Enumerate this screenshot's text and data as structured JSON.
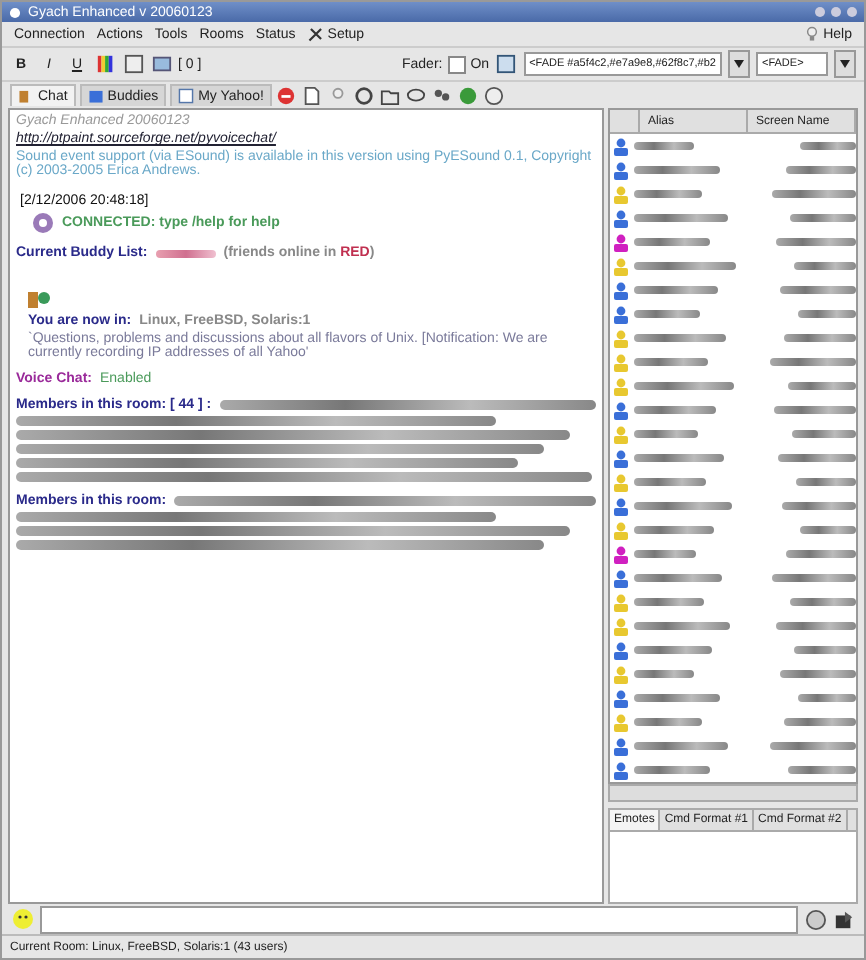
{
  "window": {
    "title": "Gyach Enhanced v 20060123"
  },
  "menu": [
    {
      "label": "Connection"
    },
    {
      "label": "Actions"
    },
    {
      "label": "Tools"
    },
    {
      "label": "Rooms"
    },
    {
      "label": "Status"
    },
    {
      "label": "Setup",
      "kind": "icon"
    }
  ],
  "help": "Help",
  "format_toolbar": {
    "format_buttons": [
      {
        "label": "B",
        "kind": "bold"
      },
      {
        "label": "I",
        "kind": "italic"
      },
      {
        "label": "U",
        "kind": "underline"
      }
    ],
    "counter": "[ 0 ]",
    "fader_label": "Fader:",
    "fader_checkbox": {
      "label": "On",
      "checked": false
    },
    "fade_field": "<FADE #a5f4c2,#e7a9e8,#62f8c7,#b2",
    "fade_field_2": "<FADE>"
  },
  "tabs": [
    {
      "label": "Chat",
      "selected": true
    },
    {
      "label": "Buddies",
      "selected": false
    },
    {
      "label": "My Yahoo!",
      "selected": false
    }
  ],
  "chat": [
    {
      "kind": "intro",
      "text": "Gyach Enhanced 20060123"
    },
    {
      "kind": "link",
      "text": "http://ptpaint.sourceforge.net/pyvoicechat/"
    },
    {
      "kind": "info",
      "text": "Sound event support (via ESound) is available in this version using PyESound 0.1, Copyright (c) 2003-2005 Erica Andrews."
    },
    {
      "kind": "timestamp",
      "text": "[2/12/2006 20:48:18]"
    },
    {
      "kind": "connected",
      "text": "CONNECTED: type /help for help"
    },
    {
      "kind": "buddies",
      "label": "Current Buddy List:",
      "before": "(friends online in ",
      "highlight": "RED",
      "after": ")"
    },
    {
      "kind": "room",
      "label": "You are now in:",
      "value": "Linux, FreeBSD, Solaris:1",
      "topic": "`Questions, problems and discussions about all flavors of Unix. [Notification: We are currently recording IP addresses of all Yahoo'"
    },
    {
      "kind": "voice",
      "label": "Voice Chat:",
      "value": "Enabled"
    },
    {
      "kind": "members",
      "label": "Members in this room:  [ 44 ] :"
    },
    {
      "kind": "members",
      "label": "Members in this room:"
    }
  ],
  "buddy_list": {
    "columns": [
      "Alias",
      "Screen Name"
    ],
    "rows": [
      {
        "color": "#3a6fd8"
      },
      {
        "color": "#3a6fd8"
      },
      {
        "color": "#e8c830"
      },
      {
        "color": "#3a6fd8"
      },
      {
        "color": "#d020c0"
      },
      {
        "color": "#e8c830"
      },
      {
        "color": "#3a6fd8"
      },
      {
        "color": "#3a6fd8"
      },
      {
        "color": "#e8c830"
      },
      {
        "color": "#e8c830"
      },
      {
        "color": "#e8c830"
      },
      {
        "color": "#3a6fd8"
      },
      {
        "color": "#e8c830"
      },
      {
        "color": "#3a6fd8"
      },
      {
        "color": "#e8c830"
      },
      {
        "color": "#3a6fd8"
      },
      {
        "color": "#e8c830"
      },
      {
        "color": "#d020c0"
      },
      {
        "color": "#3a6fd8"
      },
      {
        "color": "#e8c830"
      },
      {
        "color": "#e8c830"
      },
      {
        "color": "#3a6fd8"
      },
      {
        "color": "#e8c830"
      },
      {
        "color": "#3a6fd8"
      },
      {
        "color": "#e8c830"
      },
      {
        "color": "#3a6fd8"
      },
      {
        "color": "#3a6fd8"
      }
    ]
  },
  "bottom_tabs": [
    {
      "label": "Emotes",
      "selected": true
    },
    {
      "label": "Cmd Format #1",
      "selected": false
    },
    {
      "label": "Cmd Format #2",
      "selected": false
    }
  ],
  "status_bar": "Current Room: Linux, FreeBSD, Solaris:1  (43 users)"
}
